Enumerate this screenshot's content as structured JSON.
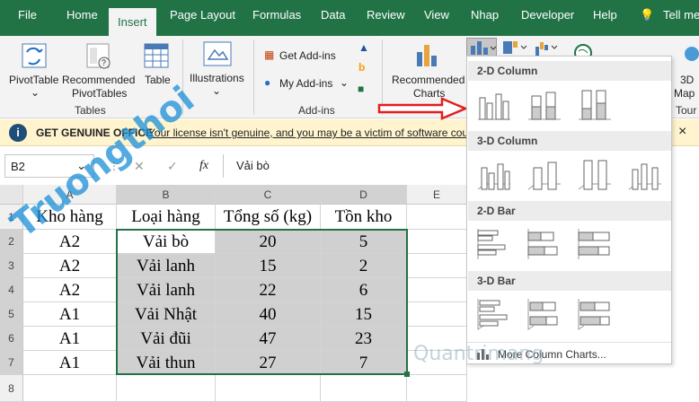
{
  "ribbon_tabs": [
    "File",
    "Home",
    "Insert",
    "Page Layout",
    "Formulas",
    "Data",
    "Review",
    "View",
    "Nhap",
    "Developer",
    "Help",
    "Tell me"
  ],
  "ribbon": {
    "pivottable": "PivotTable",
    "recommended_pivot_1": "Recommended",
    "recommended_pivot_2": "PivotTables",
    "table": "Table",
    "tables_group": "Tables",
    "illustrations": "Illustrations",
    "get_addins": "Get Add-ins",
    "my_addins": "My Add-ins",
    "addins_group": "Add-ins",
    "recommended_charts_1": "Recommended",
    "recommended_charts_2": "Charts",
    "map_3d_1": "3D",
    "map_3d_2": "Map",
    "tours_group": "Tour"
  },
  "banner": {
    "title": "GET GENUINE OFFICE",
    "message": "Your license isn't genuine, and you may be a victim of software cou",
    "close": "×"
  },
  "formula_bar": {
    "name_box": "B2",
    "cancel": "✕",
    "enter": "✓",
    "fx": "fx",
    "value": "Vải bò"
  },
  "columns": [
    "A",
    "B",
    "C",
    "D",
    "E"
  ],
  "rows": [
    "1",
    "2",
    "3",
    "4",
    "5",
    "6",
    "7",
    "8"
  ],
  "table": {
    "header": [
      "Kho hàng",
      "Loại hàng",
      "Tổng số (kg)",
      "Tồn kho"
    ],
    "rows": [
      [
        "A2",
        "Vải bò",
        "20",
        "5"
      ],
      [
        "A2",
        "Vải lanh",
        "15",
        "2"
      ],
      [
        "A2",
        "Vải lanh",
        "22",
        "6"
      ],
      [
        "A1",
        "Vải Nhật",
        "40",
        "15"
      ],
      [
        "A1",
        "Vải đũi",
        "47",
        "23"
      ],
      [
        "A1",
        "Vải thun",
        "27",
        "7"
      ]
    ]
  },
  "chart_dropdown": {
    "sections": [
      "2-D Column",
      "3-D Column",
      "2-D Bar",
      "3-D Bar"
    ],
    "more": "More Column Charts..."
  },
  "watermark": "Truongthoi",
  "watermark2": "Quantrimang"
}
